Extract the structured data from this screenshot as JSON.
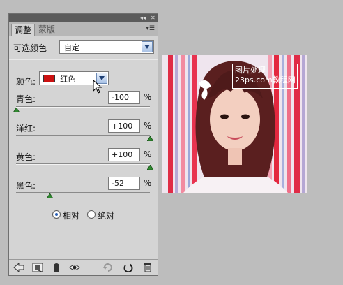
{
  "panel": {
    "tabs": [
      {
        "label": "调整"
      },
      {
        "label": "蒙版"
      }
    ],
    "preset": {
      "label": "可选颜色",
      "value": "自定"
    },
    "colors": {
      "label": "颜色:",
      "value": "红色",
      "swatch": "#cc1111"
    },
    "sliders": [
      {
        "label": "青色:",
        "value": "-100",
        "unit": "%",
        "level": -100
      },
      {
        "label": "洋红:",
        "value": "+100",
        "unit": "%",
        "level": 100
      },
      {
        "label": "黄色:",
        "value": "+100",
        "unit": "%",
        "level": 100
      },
      {
        "label": "黑色:",
        "value": "-52",
        "unit": "%",
        "level": -52
      }
    ],
    "method": {
      "options": [
        "相对",
        "绝对"
      ],
      "selected": "相对"
    }
  },
  "photo": {
    "watermark_line1": "图片处理",
    "watermark_line2": "23ps.com",
    "watermark_line3": "教程网"
  },
  "colors": {
    "panel_bg": "#d4d4d4",
    "accent": "#2a5fb5",
    "slider_thumb": "#2f8a2f"
  }
}
